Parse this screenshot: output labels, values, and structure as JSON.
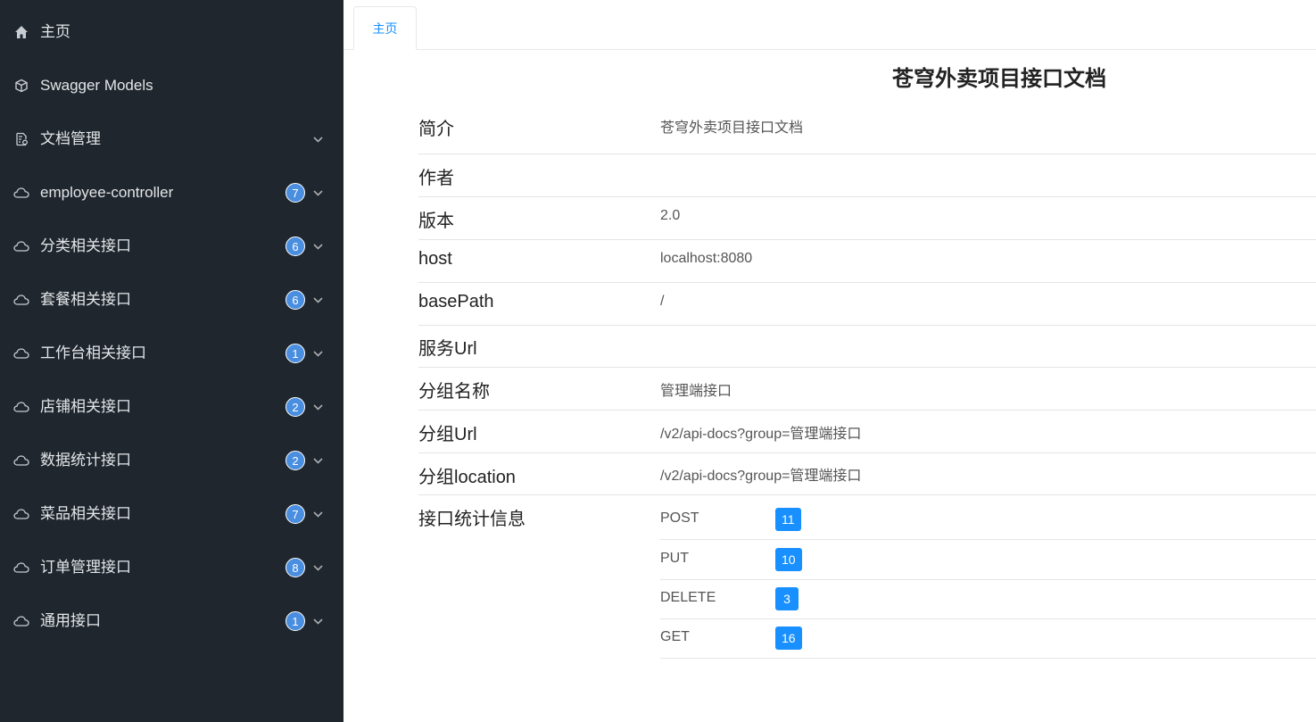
{
  "sidebar": {
    "items": [
      {
        "label": "主页",
        "icon": "home-icon",
        "badge": null,
        "expandable": false
      },
      {
        "label": "Swagger Models",
        "icon": "cube-icon",
        "badge": null,
        "expandable": false
      },
      {
        "label": "文档管理",
        "icon": "document-settings-icon",
        "badge": null,
        "expandable": true
      },
      {
        "label": "employee-controller",
        "icon": "cloud-icon",
        "badge": "7",
        "expandable": true
      },
      {
        "label": "分类相关接口",
        "icon": "cloud-icon",
        "badge": "6",
        "expandable": true
      },
      {
        "label": "套餐相关接口",
        "icon": "cloud-icon",
        "badge": "6",
        "expandable": true
      },
      {
        "label": "工作台相关接口",
        "icon": "cloud-icon",
        "badge": "1",
        "expandable": true
      },
      {
        "label": "店铺相关接口",
        "icon": "cloud-icon",
        "badge": "2",
        "expandable": true
      },
      {
        "label": "数据统计接口",
        "icon": "cloud-icon",
        "badge": "2",
        "expandable": true
      },
      {
        "label": "菜品相关接口",
        "icon": "cloud-icon",
        "badge": "7",
        "expandable": true
      },
      {
        "label": "订单管理接口",
        "icon": "cloud-icon",
        "badge": "8",
        "expandable": true
      },
      {
        "label": "通用接口",
        "icon": "cloud-icon",
        "badge": "1",
        "expandable": true
      }
    ]
  },
  "tabs": [
    {
      "label": "主页",
      "active": true
    }
  ],
  "doc": {
    "title": "苍穹外卖项目接口文档",
    "rows": [
      {
        "label": "简介",
        "value": "苍穹外卖项目接口文档"
      },
      {
        "label": "作者",
        "value": ""
      },
      {
        "label": "版本",
        "value": "2.0"
      },
      {
        "label": "host",
        "value": "localhost:8080"
      },
      {
        "label": "basePath",
        "value": "/"
      },
      {
        "label": "服务Url",
        "value": ""
      },
      {
        "label": "分组名称",
        "value": "管理端接口"
      },
      {
        "label": "分组Url",
        "value": "/v2/api-docs?group=管理端接口"
      },
      {
        "label": "分组location",
        "value": "/v2/api-docs?group=管理端接口"
      }
    ],
    "stats_label": "接口统计信息",
    "stats": [
      {
        "method": "POST",
        "count": "11"
      },
      {
        "method": "PUT",
        "count": "10"
      },
      {
        "method": "DELETE",
        "count": "3"
      },
      {
        "method": "GET",
        "count": "16"
      }
    ]
  },
  "colors": {
    "sidebar_bg": "#1f262d",
    "badge_bg": "#4a8ee0",
    "accent": "#1890ff"
  }
}
